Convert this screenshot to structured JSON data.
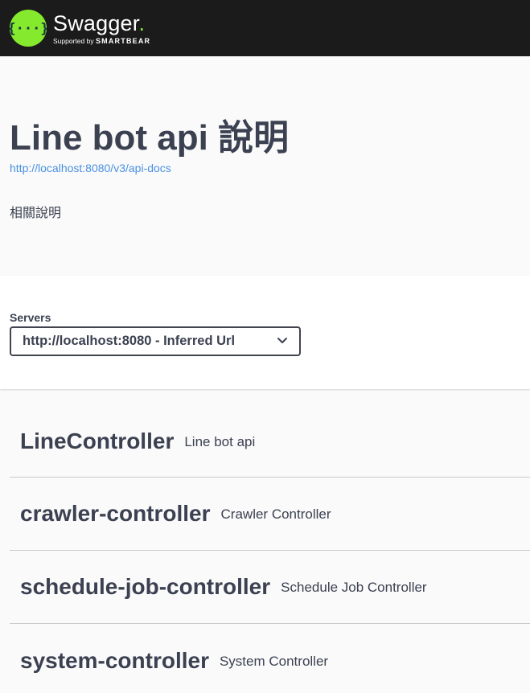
{
  "topbar": {
    "logo_title": "Swagger",
    "logo_supported": "Supported by",
    "logo_brand": "SMARTBEAR",
    "brand_color": "#85ea2d",
    "icon": "swagger-braces-icon"
  },
  "info": {
    "title": "Line bot api 說明",
    "spec_url": "http://localhost:8080/v3/api-docs",
    "description": "相關說明"
  },
  "servers": {
    "label": "Servers",
    "selected": "http://localhost:8080 - Inferred Url",
    "dropdown_icon": "chevron-down-icon"
  },
  "tags": [
    {
      "name": "LineController",
      "description": "Line bot api"
    },
    {
      "name": "crawler-controller",
      "description": "Crawler Controller"
    },
    {
      "name": "schedule-job-controller",
      "description": "Schedule Job Controller"
    },
    {
      "name": "system-controller",
      "description": "System Controller"
    }
  ],
  "colors": {
    "topbar_bg": "#1b1b1b",
    "text": "#3b4151",
    "link": "#4990e2"
  }
}
